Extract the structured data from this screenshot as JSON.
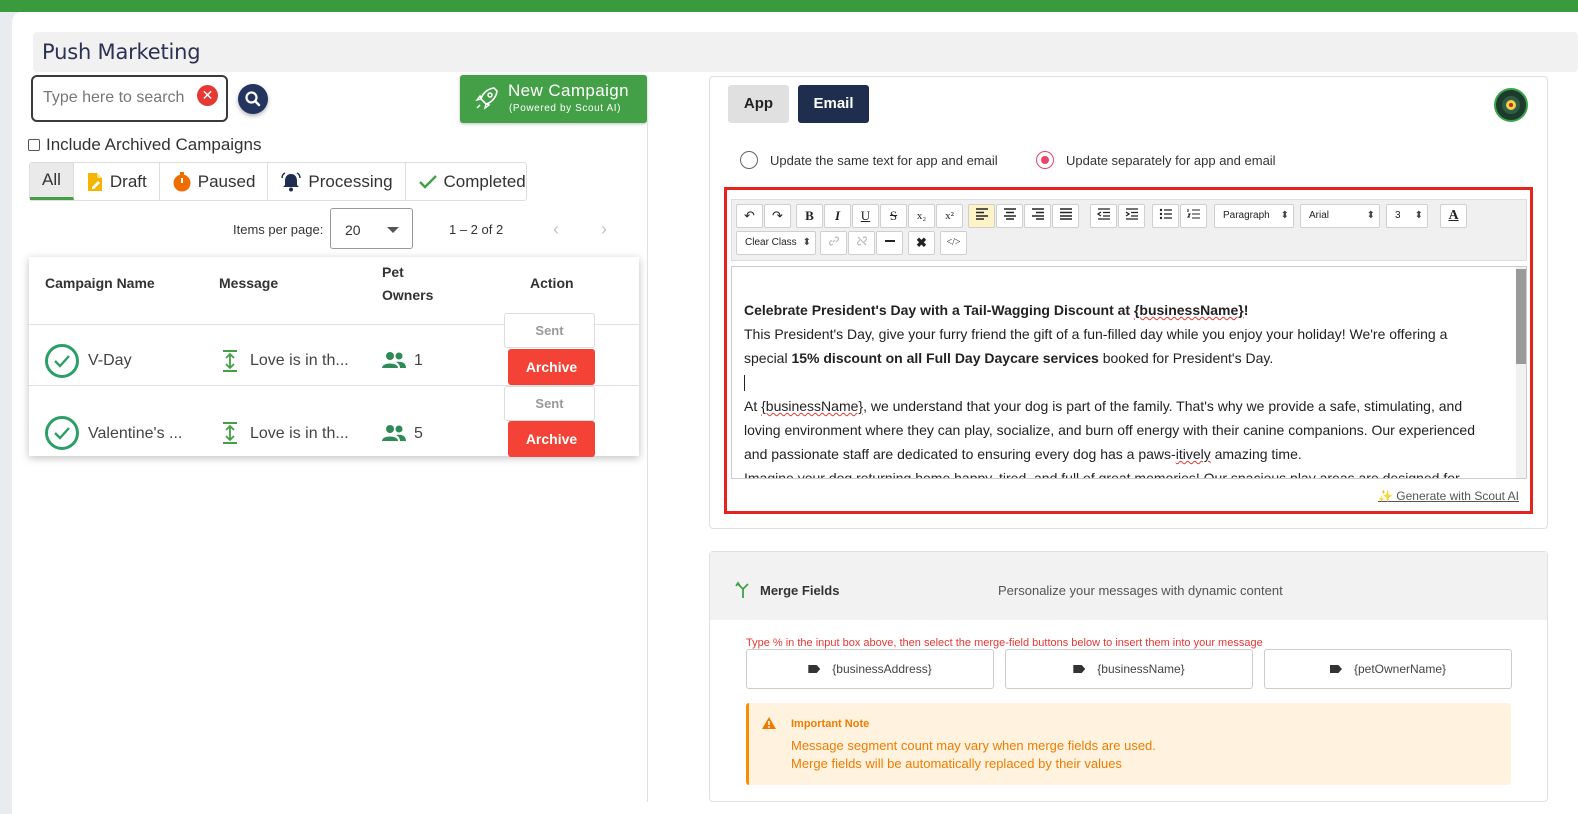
{
  "page": {
    "title": "Push Marketing"
  },
  "search": {
    "placeholder": "Type here to search"
  },
  "new_campaign": {
    "label": "New Campaign",
    "sublabel": "(Powered by Scout AI)"
  },
  "archived": {
    "label": "Include Archived Campaigns",
    "checked": false
  },
  "tabs": [
    {
      "label": "All",
      "icon": "list-icon",
      "active": true
    },
    {
      "label": "Draft",
      "icon": "draft-icon",
      "color": "#f4b400"
    },
    {
      "label": "Paused",
      "icon": "timer-icon",
      "color": "#ef6c00"
    },
    {
      "label": "Processing",
      "icon": "bell-icon",
      "color": "#1f2e4f"
    },
    {
      "label": "Completed",
      "icon": "check-icon",
      "color": "#43a047"
    }
  ],
  "pagination": {
    "items_per_page_label": "Items per page:",
    "items_per_page": "20",
    "range": "1 – 2 of 2"
  },
  "table": {
    "headers": {
      "name": "Campaign Name",
      "message": "Message",
      "owners_line1": "Pet",
      "owners_line2": "Owners",
      "action": "Action"
    },
    "rows": [
      {
        "name": "V-Day",
        "message": "Love is in th...",
        "owners": "1",
        "sent": "Sent",
        "archive": "Archive"
      },
      {
        "name": "Valentine's ...",
        "message": "Love is in th...",
        "owners": "5",
        "sent": "Sent",
        "archive": "Archive"
      }
    ]
  },
  "channel": {
    "app": "App",
    "email": "Email",
    "selected": "Email"
  },
  "update_mode": {
    "same": "Update the same text for app and email",
    "separate": "Update separately for app and email",
    "selected": "separate"
  },
  "toolbar": {
    "paragraph": "Paragraph",
    "font": "Arial",
    "size": "3",
    "clear_class": "Clear Class"
  },
  "editor": {
    "heading_a": "Celebrate President's Day with a Tail-Wagging Discount at ",
    "heading_var": "{businessName}",
    "heading_end": "!",
    "p1": "This President's Day, give your furry friend the gift of a fun-filled day while you enjoy your holiday! We're offering a",
    "p2_a": "special ",
    "p2_bold": "15% discount on all Full Day Daycare services",
    "p2_b": " booked for President's Day.",
    "p3_a": "At ",
    "p3_var": "{businessName}",
    "p3_b": ", we understand that your dog is part of the family. That's why we provide a safe, stimulating, and",
    "p4": "loving environment where they can play, socialize, and burn off energy with their canine companions. Our experienced",
    "p5_a": "and passionate staff are dedicated to ensuring every dog has a paws-",
    "p5_sq": "itively",
    "p5_b": " amazing time.",
    "p6": "Imagine your dog returning home happy, tired, and full of great memories! Our spacious play areas are designed for"
  },
  "generate": {
    "label": "✨ Generate with Scout AI"
  },
  "merge": {
    "title": "Merge Fields",
    "subtitle": "Personalize your messages with dynamic content",
    "hint": "Type % in the input box above, then select the merge-field buttons below to insert them into your message",
    "fields": [
      "{businessAddress}",
      "{businessName}",
      "{petOwnerName}"
    ],
    "note_title": "Important Note",
    "note_line1": "Message segment count may vary when merge fields are used.",
    "note_line2": "Merge fields will be automatically replaced by their values"
  },
  "colors": {
    "brand_green": "#43a047",
    "navy": "#1f2e4f",
    "danger": "#f44336",
    "highlight": "#e52420"
  }
}
